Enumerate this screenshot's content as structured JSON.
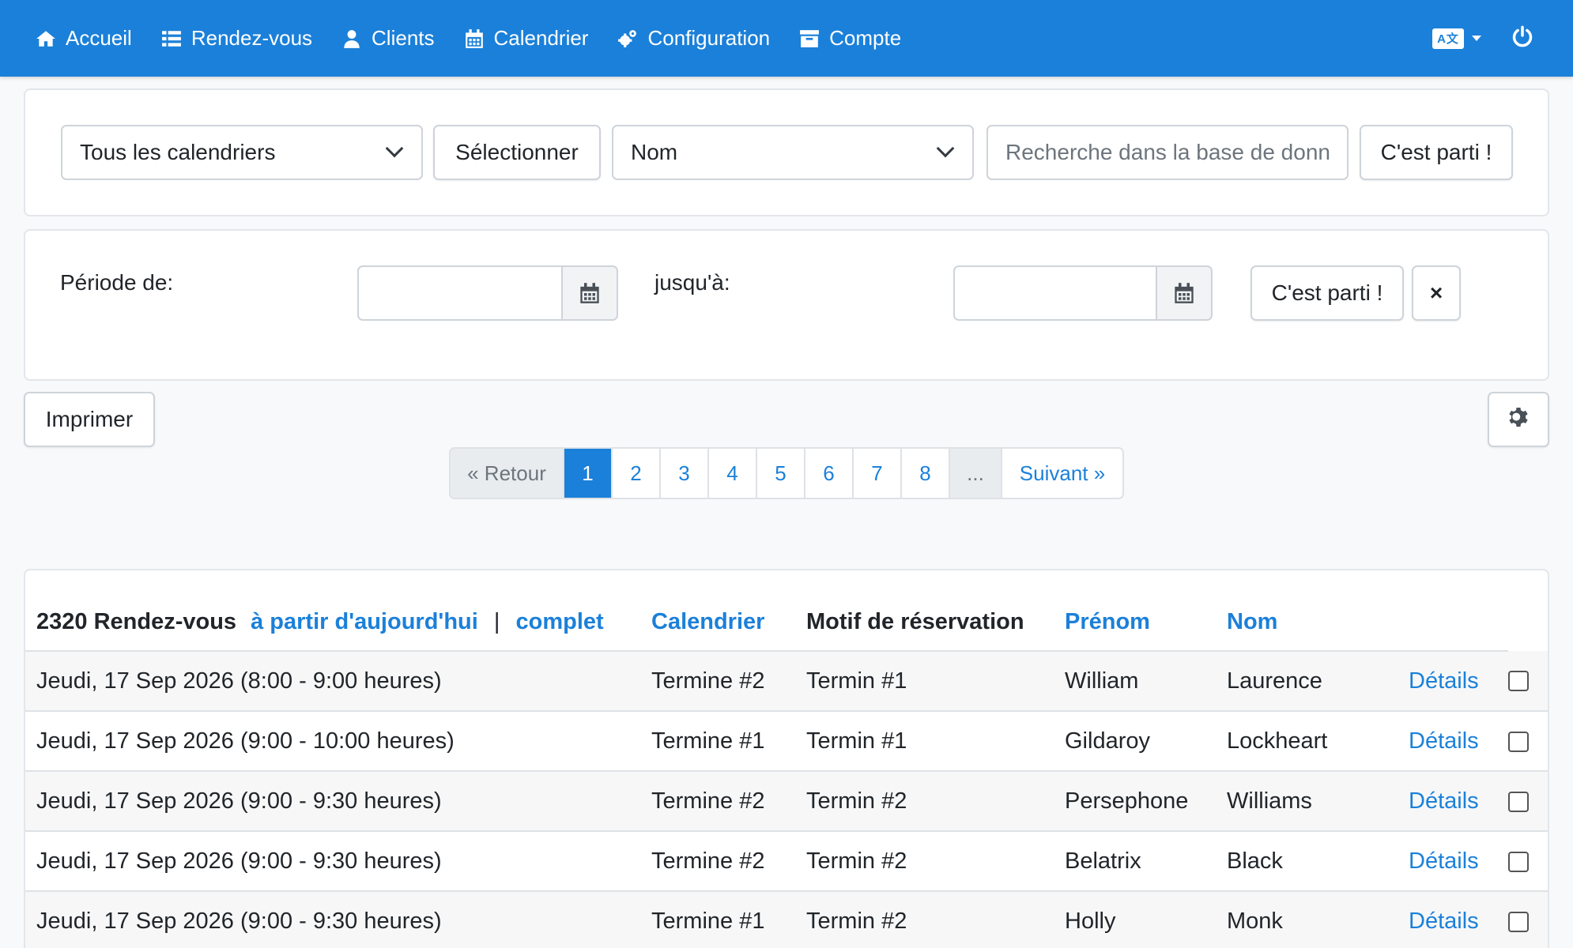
{
  "nav": {
    "items": [
      {
        "label": "Accueil",
        "icon": "home-icon"
      },
      {
        "label": "Rendez-vous",
        "icon": "list-icon"
      },
      {
        "label": "Clients",
        "icon": "user-icon"
      },
      {
        "label": "Calendrier",
        "icon": "calendar-icon"
      },
      {
        "label": "Configuration",
        "icon": "gears-icon"
      },
      {
        "label": "Compte",
        "icon": "archive-icon"
      }
    ],
    "language_icon": "language-icon",
    "logout_icon": "power-icon"
  },
  "search": {
    "calendar_select": "Tous les calendriers",
    "select_button": "Sélectionner",
    "field_select": "Nom",
    "search_placeholder": "Recherche dans la base de données",
    "go_button": "C'est parti !"
  },
  "period": {
    "from_label": "Période de:",
    "to_label": "jusqu'à:",
    "go_button": "C'est parti !",
    "clear_button": "×"
  },
  "toolbar": {
    "print_button": "Imprimer",
    "settings_icon": "gear-icon"
  },
  "pagination": {
    "prev": "« Retour",
    "pages": [
      "1",
      "2",
      "3",
      "4",
      "5",
      "6",
      "7",
      "8"
    ],
    "active_page": "1",
    "ellipsis": "...",
    "next": "Suivant »"
  },
  "table": {
    "count_label": "2320 Rendez-vous",
    "filter_today": "à partir d'aujourd'hui",
    "separator": "|",
    "filter_all": "complet",
    "columns": {
      "calendar": "Calendrier",
      "reason": "Motif de réservation",
      "firstname": "Prénom",
      "lastname": "Nom"
    },
    "details_label": "Détails",
    "rows": [
      {
        "date": "Jeudi, 17 Sep 2026 (8:00 - 9:00 heures)",
        "calendar": "Termine #2",
        "reason": "Termin #1",
        "firstname": "William",
        "lastname": "Laurence"
      },
      {
        "date": "Jeudi, 17 Sep 2026 (9:00 - 10:00 heures)",
        "calendar": "Termine #1",
        "reason": "Termin #1",
        "firstname": "Gildaroy",
        "lastname": "Lockheart"
      },
      {
        "date": "Jeudi, 17 Sep 2026 (9:00 - 9:30 heures)",
        "calendar": "Termine #2",
        "reason": "Termin #2",
        "firstname": "Persephone",
        "lastname": "Williams"
      },
      {
        "date": "Jeudi, 17 Sep 2026 (9:00 - 9:30 heures)",
        "calendar": "Termine #2",
        "reason": "Termin #2",
        "firstname": "Belatrix",
        "lastname": "Black"
      },
      {
        "date": "Jeudi, 17 Sep 2026 (9:00 - 9:30 heures)",
        "calendar": "Termine #1",
        "reason": "Termin #2",
        "firstname": "Holly",
        "lastname": "Monk"
      }
    ]
  },
  "colors": {
    "primary": "#1b80d9",
    "background": "#f8f9fa"
  }
}
